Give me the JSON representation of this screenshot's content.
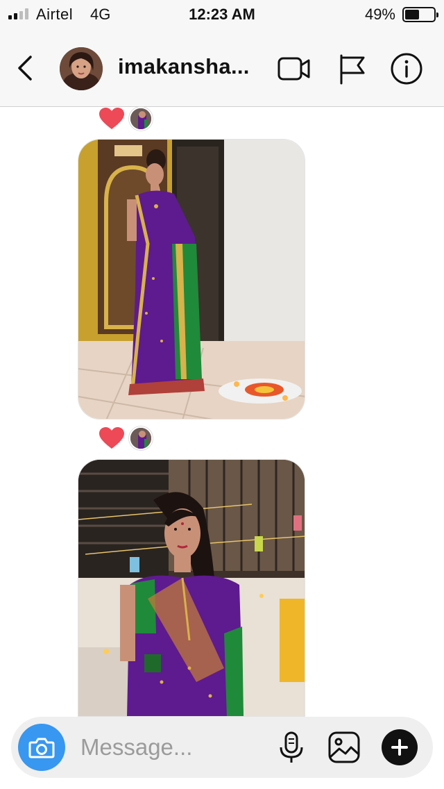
{
  "status_bar": {
    "carrier": "Airtel",
    "network": "4G",
    "time": "12:23 AM",
    "battery_percent": "49%",
    "battery_level": 0.49,
    "signal_bars_on": 2,
    "signal_bars_total": 4
  },
  "header": {
    "username": "imakansha...",
    "back_icon": "chevron-left-icon",
    "video_icon": "video-call-icon",
    "flag_icon": "flag-icon",
    "info_icon": "info-icon"
  },
  "messages": [
    {
      "type": "photo",
      "reaction": "heart",
      "description_icon": "photo-message"
    },
    {
      "type": "photo",
      "reaction": "heart",
      "description_icon": "photo-message"
    }
  ],
  "composer": {
    "placeholder": "Message...",
    "camera_icon": "camera-icon",
    "mic_icon": "microphone-icon",
    "gallery_icon": "gallery-icon",
    "plus_icon": "plus-icon"
  },
  "colors": {
    "accent": "#3897f0",
    "heart": "#ed4956",
    "header_bg": "#f7f7f7",
    "saree_purple": "#5e1a8f",
    "saree_green": "#1f8a3a"
  }
}
